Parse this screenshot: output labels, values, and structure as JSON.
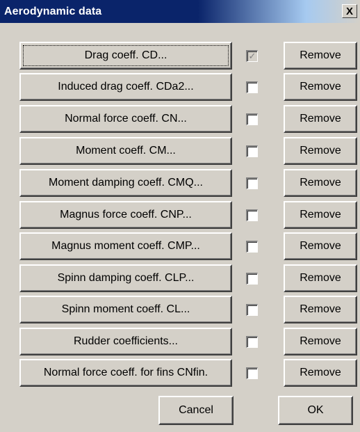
{
  "window": {
    "title": "Aerodynamic data",
    "close_label": "X"
  },
  "rows": [
    {
      "label": "Drag coeff. CD...",
      "checked": true
    },
    {
      "label": "Induced drag coeff. CDa2...",
      "checked": false
    },
    {
      "label": "Normal force coeff. CN...",
      "checked": false
    },
    {
      "label": "Moment coeff. CM...",
      "checked": false
    },
    {
      "label": "Moment damping coeff. CMQ...",
      "checked": false
    },
    {
      "label": "Magnus force coeff. CNP...",
      "checked": false
    },
    {
      "label": "Magnus moment coeff. CMP...",
      "checked": false
    },
    {
      "label": "Spinn damping coeff. CLP...",
      "checked": false
    },
    {
      "label": "Spinn moment coeff. CL...",
      "checked": false
    },
    {
      "label": "Rudder coefficients...",
      "checked": false
    },
    {
      "label": "Normal force coeff. for fins CNfin.",
      "checked": false
    }
  ],
  "remove_label": "Remove",
  "footer": {
    "cancel_label": "Cancel",
    "ok_label": "OK"
  }
}
